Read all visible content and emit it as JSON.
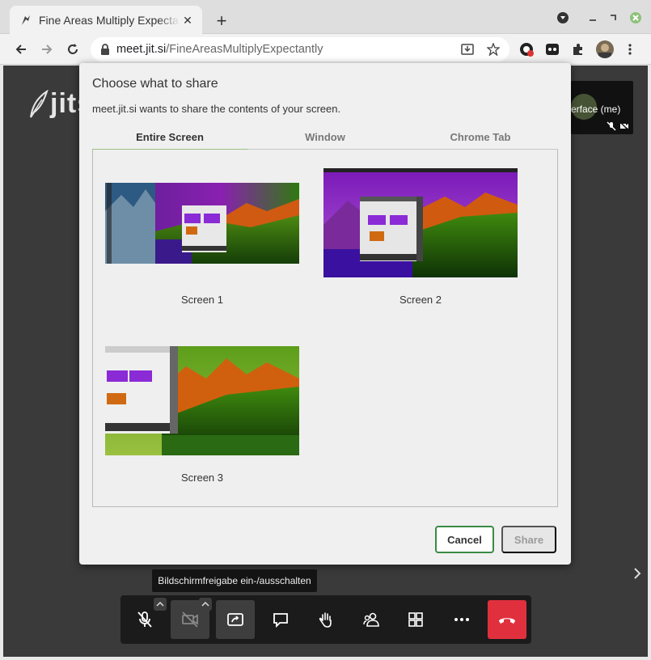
{
  "browser": {
    "tab_title": "Fine Areas Multiply Expectantly",
    "url_host": "meet.jit.si",
    "url_path": "/FineAreasMultiplyExpectantly",
    "icons": [
      "jitsi-favicon",
      "close-icon",
      "plus-icon",
      "media-icon",
      "minimize-icon",
      "restore-icon",
      "close-window-icon",
      "back-arrow-icon",
      "forward-arrow-icon",
      "reload-icon",
      "lock-icon",
      "install-icon",
      "star-icon",
      "vpn-extension-icon",
      "dark-extension-icon",
      "puzzle-icon",
      "avatar",
      "more-vert-icon"
    ]
  },
  "page": {
    "logo_text": "jits",
    "self_view_name": "erface (me)"
  },
  "dialog": {
    "title": "Choose what to share",
    "subtitle": "meet.jit.si wants to share the contents of your screen.",
    "tabs": [
      "Entire Screen",
      "Window",
      "Chrome Tab"
    ],
    "active_tab": "Entire Screen",
    "screens": [
      {
        "label": "Screen 1"
      },
      {
        "label": "Screen 2"
      },
      {
        "label": "Screen 3"
      }
    ],
    "cancel_label": "Cancel",
    "share_label": "Share",
    "accent_color": "#3a8a44"
  },
  "tooltip": "Bildschirmfreigabe ein-/ausschalten",
  "toolbox": {
    "buttons": [
      "mic-muted-icon",
      "camera-off-icon",
      "screenshare-icon",
      "chat-icon",
      "raise-hand-icon",
      "participants-icon",
      "tile-view-icon",
      "more-icon",
      "hangup-icon"
    ],
    "hangup_color": "#e0303e"
  }
}
